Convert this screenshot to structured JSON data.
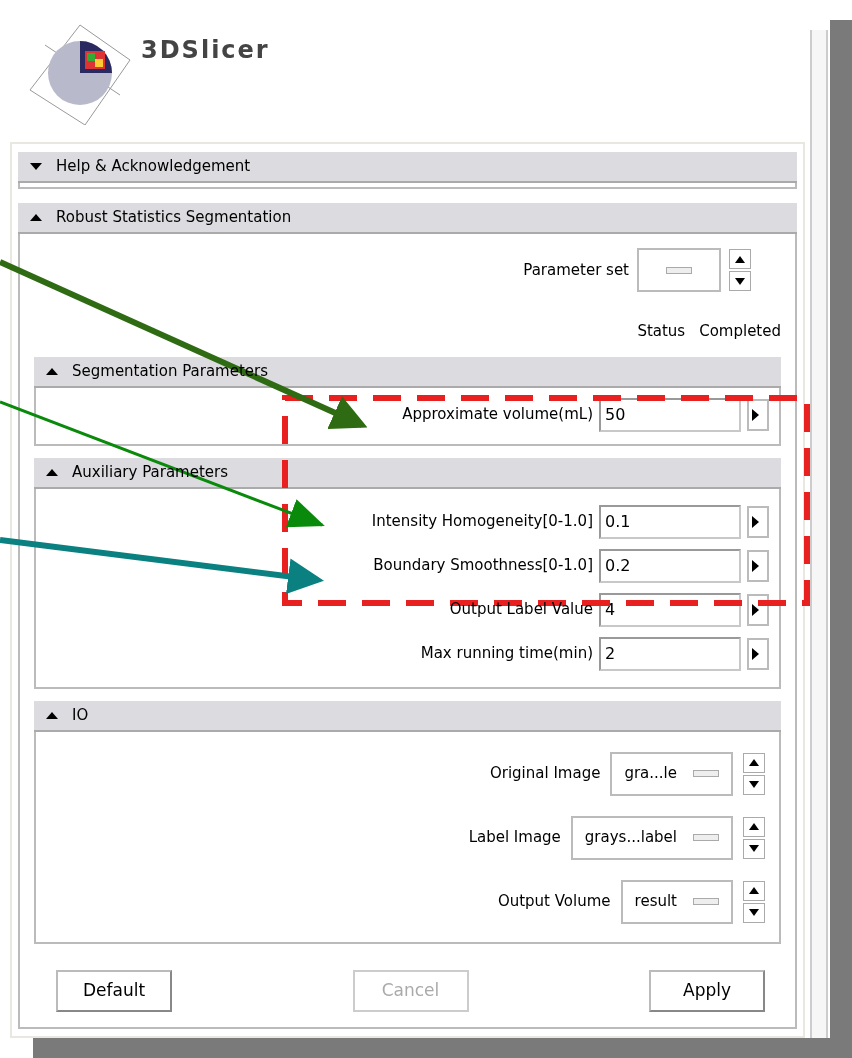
{
  "logo": {
    "text": "3DSlicer"
  },
  "help_section": {
    "title": "Help & Acknowledgement",
    "expanded": false
  },
  "module_section": {
    "title": "Robust Statistics Segmentation",
    "expanded": true,
    "parameter_set": {
      "label": "Parameter set"
    },
    "status": {
      "label": "Status",
      "value": "Completed"
    },
    "groups": [
      {
        "title": "Segmentation Parameters",
        "expanded": true,
        "fields": [
          {
            "label": "Approximate volume(mL)",
            "value": "50"
          }
        ]
      },
      {
        "title": "Auxiliary Parameters",
        "expanded": true,
        "fields": [
          {
            "label": "Intensity Homogeneity[0-1.0]",
            "value": "0.1"
          },
          {
            "label": "Boundary Smoothness[0-1.0]",
            "value": "0.2"
          },
          {
            "label": "Output Label Value",
            "value": "4"
          },
          {
            "label": "Max running time(min)",
            "value": "2"
          }
        ]
      },
      {
        "title": "IO",
        "expanded": true,
        "selectors": [
          {
            "label": "Original Image",
            "value": "gra...le"
          },
          {
            "label": "Label Image",
            "value": "grays...label"
          },
          {
            "label": "Output Volume",
            "value": "result"
          }
        ]
      }
    ],
    "buttons": [
      {
        "label": "Default",
        "disabled": false
      },
      {
        "label": "Cancel",
        "disabled": true
      },
      {
        "label": "Apply",
        "disabled": false
      }
    ]
  }
}
